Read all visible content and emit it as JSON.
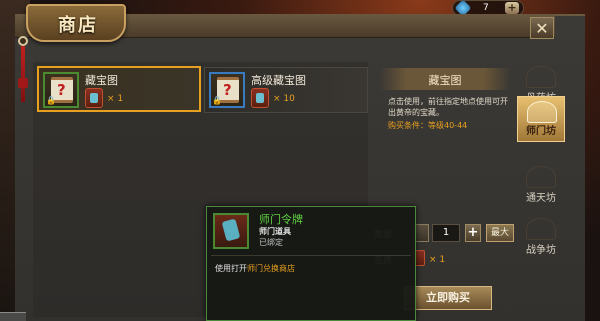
{
  "currency": {
    "amount": "7",
    "add_symbol": "+"
  },
  "window": {
    "title": "商店",
    "close_symbol": "✕"
  },
  "items": [
    {
      "name": "藏宝图",
      "cost_qty": "× 1",
      "selected": true
    },
    {
      "name": "高级藏宝图",
      "cost_qty": "× 10",
      "selected": false
    }
  ],
  "detail": {
    "name": "藏宝图",
    "description": "点击使用，前往指定地点使用可开出黄帝的宝藏。",
    "requirement": "购买条件：等级40-44"
  },
  "purchase": {
    "qty_label": "数量",
    "qty_value": "1",
    "plus_symbol": "+",
    "max_label": "最大",
    "total_label": "花费",
    "total_qty": "× 1",
    "buy_label": "立即购买"
  },
  "tooltip": {
    "name": "师门令牌",
    "type": "师门道具",
    "status": "已绑定",
    "use_prefix": "使用打开",
    "use_highlight": "师门兑换商店"
  },
  "tabs": [
    {
      "label": "丹药坊",
      "active": false
    },
    {
      "label": "师门坊",
      "active": true
    },
    {
      "label": "通天坊",
      "active": false
    },
    {
      "label": "战争坊",
      "active": false
    }
  ],
  "colors": {
    "accent": "#e8a020",
    "tooltip_name": "#60d040",
    "selected_border": "#e8a020"
  }
}
